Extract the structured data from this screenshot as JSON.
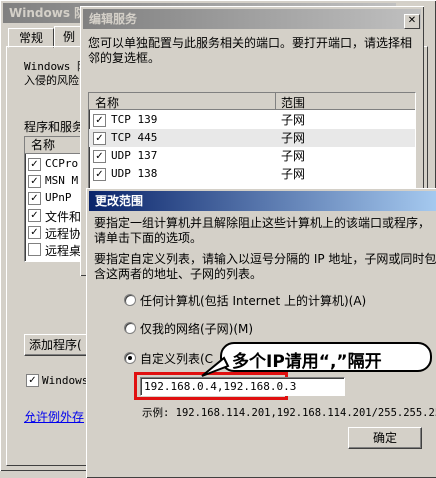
{
  "back_window": {
    "title": "Windows 防火墙",
    "tabs": [
      "常规",
      "例"
    ],
    "desc_line1": "Windows 防",
    "desc_line2": "入侵的风险",
    "programs_label": "程序和服务",
    "list_header": "名称",
    "items": [
      {
        "label": "CCPro",
        "checked": true
      },
      {
        "label": "MSN M",
        "checked": true
      },
      {
        "label": "UPnP",
        "checked": true
      },
      {
        "label": "文件和",
        "checked": true
      },
      {
        "label": "远程协",
        "checked": true
      },
      {
        "label": "远程桌",
        "checked": false
      }
    ],
    "add_program_button": "添加程序(",
    "notify_label": "Windows",
    "link_text": "允许例外存"
  },
  "edit_service": {
    "title": "编辑服务",
    "description": "您可以单独配置与此服务相关的端口。要打开端口，请选择相邻的复选框。",
    "columns": [
      "名称",
      "范围"
    ],
    "ports": [
      {
        "name": "TCP 139",
        "scope": "子网",
        "checked": true
      },
      {
        "name": "TCP 445",
        "scope": "子网",
        "checked": true
      },
      {
        "name": "UDP 137",
        "scope": "子网",
        "checked": true
      },
      {
        "name": "UDP 138",
        "scope": "子网",
        "checked": true
      }
    ]
  },
  "change_scope": {
    "title": "更改范围",
    "para1": "要指定一组计算机并且解除阻止这些计算机上的该端口或程序，请单击下面的选项。",
    "para2": "要指定自定义列表，请输入以逗号分隔的 IP 地址，子网或同时包含这两者的地址、子网的列表。",
    "option_any": "任何计算机(包括 Internet 上的计算机)(A)",
    "option_subnet": "仅我的网络(子网)(M)",
    "option_custom": "自定义列表(C",
    "custom_value": "192.168.0.4,192.168.0.3",
    "example": "示例: 192.168.114.201,192.168.114.201/255.255.255",
    "ok_button": "确定",
    "callout": "多个IP请用“,”隔开"
  }
}
